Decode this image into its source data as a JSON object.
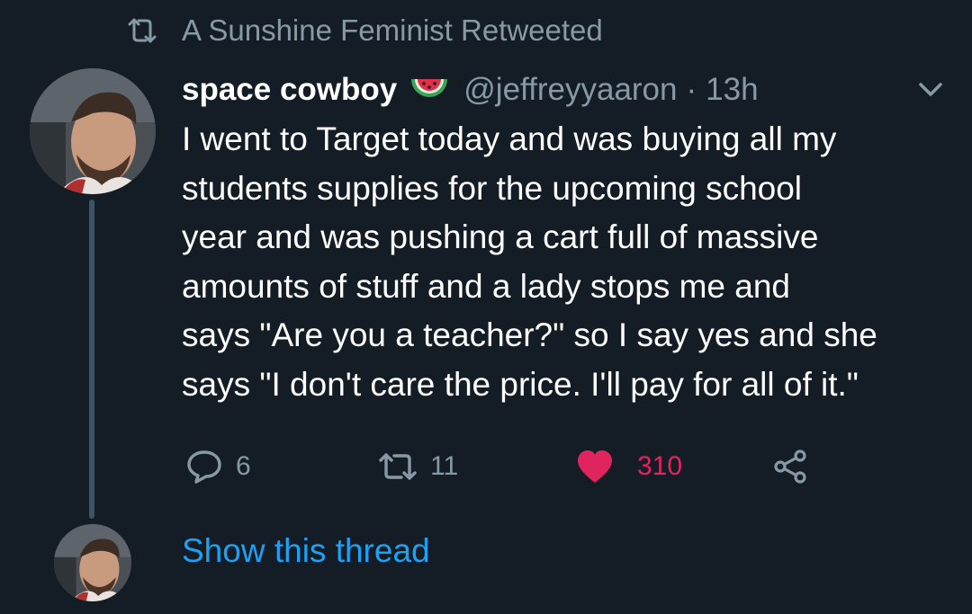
{
  "retweet": {
    "icon": "retweet-icon",
    "text": "A Sunshine Feminist Retweeted"
  },
  "tweet": {
    "author": {
      "display_name": "space cowboy",
      "emoji": "watermelon-icon",
      "handle": "@jeffreyyaaron",
      "separator": "·",
      "time": "13h"
    },
    "menu_icon": "chevron-down-icon",
    "text": "I went to Target today and was buying all my\nstudents supplies for the upcoming school\nyear and was pushing a cart full of massive\namounts of stuff and a lady stops me and\nsays \"Are you a teacher?\" so I say yes and she\nsays \"I don't care the price. I'll pay for all of it.\"",
    "actions": {
      "reply": {
        "icon": "reply-icon",
        "count": "6"
      },
      "retweet": {
        "icon": "retweet-icon",
        "count": "11"
      },
      "like": {
        "icon": "heart-icon",
        "count": "310",
        "color": "#e0245e",
        "liked": true
      },
      "share": {
        "icon": "share-icon"
      }
    }
  },
  "thread": {
    "link_text": "Show this thread"
  },
  "colors": {
    "background": "#141d26",
    "text": "#ffffff",
    "muted": "#8899a6",
    "link": "#1da1f2",
    "like": "#e0245e",
    "thread_line": "#3d5466"
  }
}
